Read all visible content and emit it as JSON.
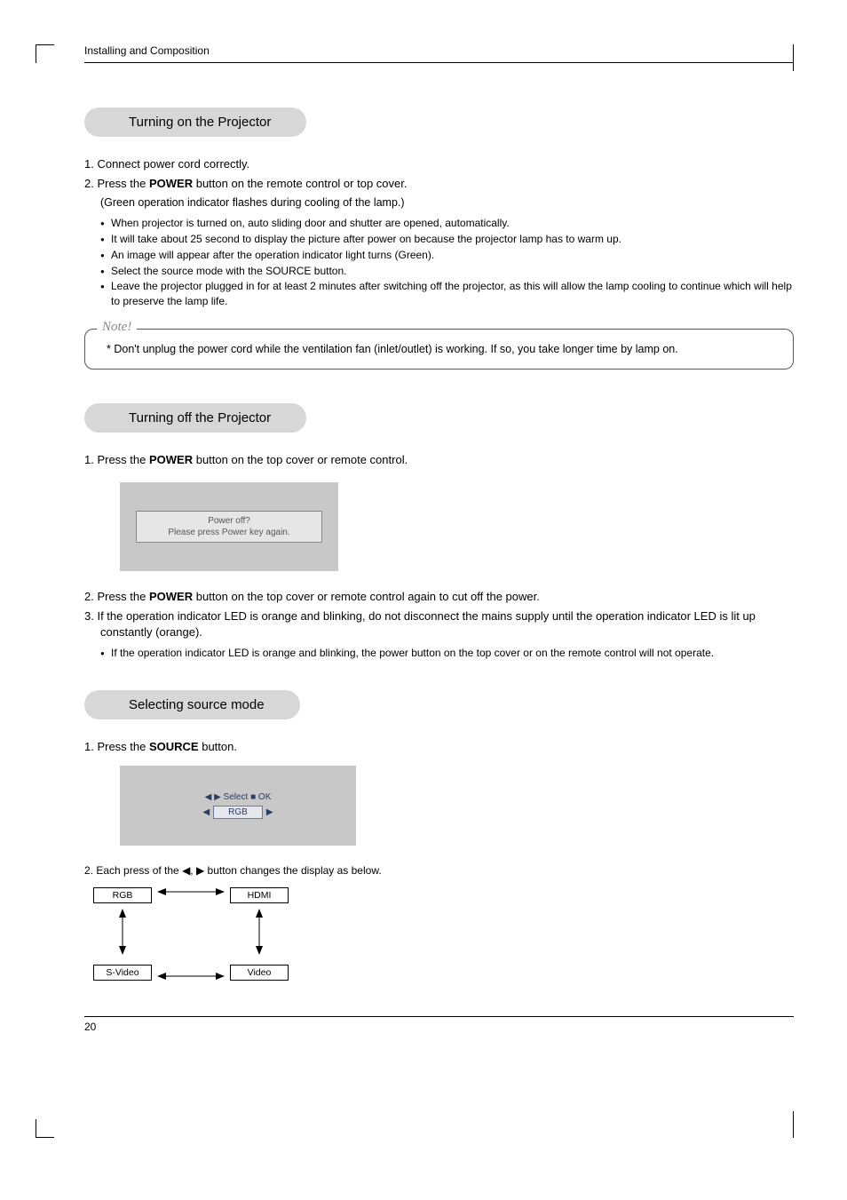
{
  "header": {
    "section": "Installing and Composition"
  },
  "sectionA": {
    "title": "Turning on the Projector",
    "step1": "1. Connect power cord correctly.",
    "step2_pre": "2. Press the ",
    "step2_bold": "POWER",
    "step2_post": " button on the remote control or top cover.",
    "step2_sub": "(Green operation indicator flashes during cooling of the lamp.)",
    "bullets": [
      "When projector is turned on, auto sliding door and shutter are opened, automatically.",
      "It will take about 25 second to display the picture after power on because the projector lamp has to warm up.",
      "An image will appear after the operation indicator light turns (Green).",
      "Select the source mode with the SOURCE button.",
      "Leave the projector plugged in for at least 2 minutes after switching off the projector, as this will allow the lamp cooling to continue which will help to preserve the lamp life."
    ]
  },
  "note": {
    "label": "Note!",
    "text": "* Don't unplug the power cord while the ventilation fan (inlet/outlet) is working. If so, you take longer time by lamp on."
  },
  "sectionB": {
    "title": "Turning off the Projector",
    "step1_pre": "1. Press the ",
    "step1_bold": "POWER",
    "step1_post": " button on the top cover or remote control.",
    "osd_line1": "Power off?",
    "osd_line2": "Please press Power key again.",
    "step2_pre": "2. Press the ",
    "step2_bold": "POWER",
    "step2_post": " button on the top cover or remote control again to cut off the power.",
    "step3": "3. If the operation indicator LED is orange and blinking, do not disconnect the mains supply until the operation indicator LED is lit up constantly (orange).",
    "bullet": "If the operation indicator LED is  orange and blinking, the power button on the top cover or on the remote control will not operate."
  },
  "sectionC": {
    "title": "Selecting source mode",
    "step1_pre": "1. Press the ",
    "step1_bold": "SOURCE",
    "step1_post": " button.",
    "osd_hint": "◀ ▶ Select     ■ OK",
    "osd_value": "RGB",
    "step2": "2. Each press of the ◀, ▶ button changes the display as below.",
    "sources": {
      "rgb": "RGB",
      "hdmi": "HDMI",
      "svideo": "S-Video",
      "video": "Video"
    }
  },
  "footer": {
    "page": "20"
  }
}
